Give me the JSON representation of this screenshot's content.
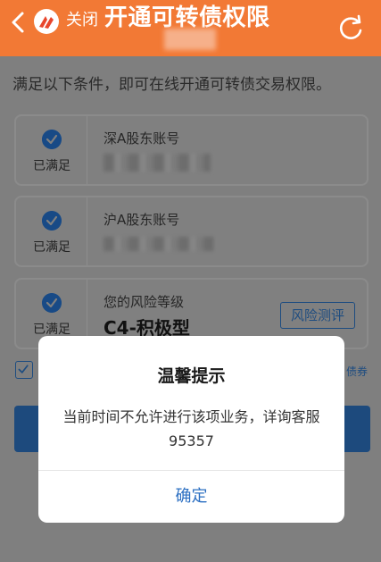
{
  "header": {
    "close_label": "关闭",
    "title": "开通可转债权限"
  },
  "intro_text": "满足以下条件，即可在线开通可转债交易权限。",
  "conditions": [
    {
      "status": "已满足",
      "label": "深A股东账号"
    },
    {
      "status": "已满足",
      "label": "沪A股东账号"
    },
    {
      "status": "已满足",
      "label": "您的风险等级",
      "value": "C4-积极型",
      "action_label": "风险测评"
    }
  ],
  "agreement": {
    "tail_text": "债券"
  },
  "dialog": {
    "title": "温馨提示",
    "message": "当前时间不允许进行该项业务，详询客服95357",
    "confirm_label": "确定"
  },
  "colors": {
    "header_bg": "#f27935",
    "accent_blue": "#2b6fc2",
    "check_blue": "#2b6fd0"
  },
  "icons": [
    "back-chevron-icon",
    "app-logo-icon",
    "refresh-icon",
    "check-circle-icon",
    "checkbox-icon"
  ]
}
